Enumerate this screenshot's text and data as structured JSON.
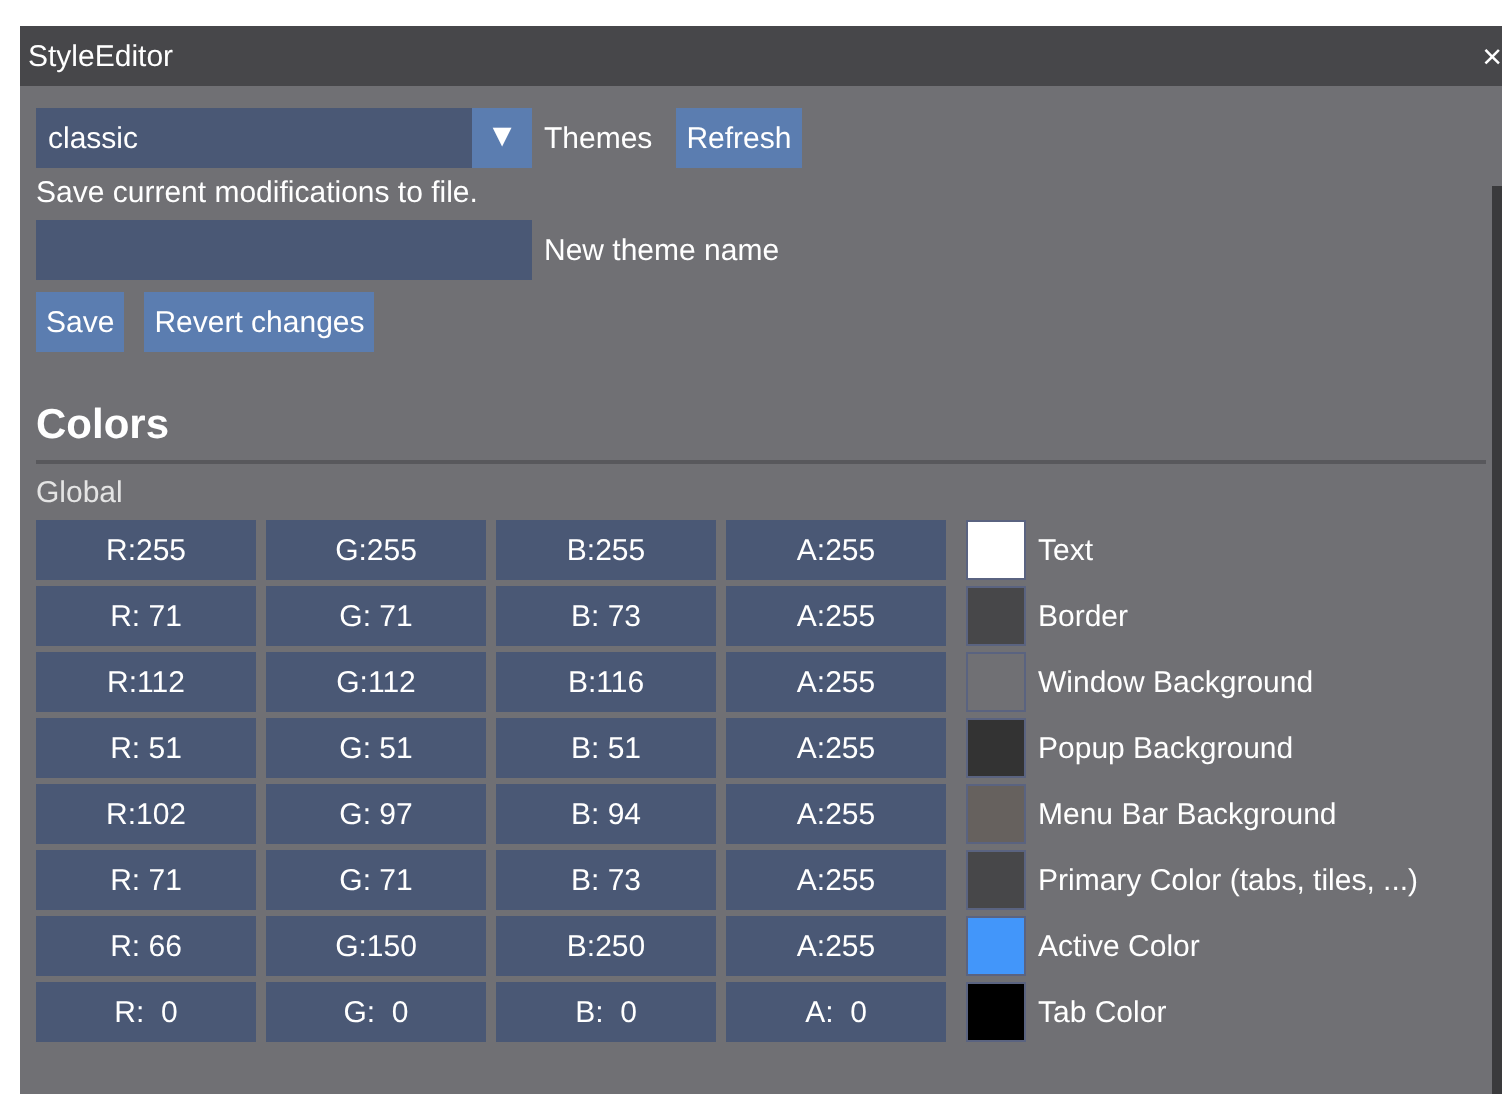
{
  "window": {
    "title": "StyleEditor",
    "close": "×"
  },
  "theme_select": {
    "value": "classic",
    "arrow": "▼",
    "label": "Themes"
  },
  "refresh_button": "Refresh",
  "save_note": "Save current modifications to file.",
  "theme_name_field": {
    "label": "New theme name"
  },
  "buttons": [
    "Save",
    "Revert changes"
  ],
  "section_heading": "Colors",
  "group_label": "Global",
  "colors": [
    {
      "channels": [
        "R:255",
        "G:255",
        "B:255",
        "A:255"
      ],
      "color": "#ffffff",
      "label": "Text"
    },
    {
      "channels": [
        "R: 71",
        "G: 71",
        "B: 73",
        "A:255"
      ],
      "color": "#474749",
      "label": "Border"
    },
    {
      "channels": [
        "R:112",
        "G:112",
        "B:116",
        "A:255"
      ],
      "color": "#707074",
      "label": "Window Background"
    },
    {
      "channels": [
        "R: 51",
        "G: 51",
        "B: 51",
        "A:255"
      ],
      "color": "#333333",
      "label": "Popup Background"
    },
    {
      "channels": [
        "R:102",
        "G: 97",
        "B: 94",
        "A:255"
      ],
      "color": "#66615e",
      "label": "Menu Bar Background"
    },
    {
      "channels": [
        "R: 71",
        "G: 71",
        "B: 73",
        "A:255"
      ],
      "color": "#474749",
      "label": "Primary Color (tabs, tiles, ...)"
    },
    {
      "channels": [
        "R: 66",
        "G:150",
        "B:250",
        "A:255"
      ],
      "color": "#4296fa",
      "label": "Active Color"
    },
    {
      "channels": [
        "R:  0",
        "G:  0",
        "B:  0",
        "A:  0"
      ],
      "color": "#000000",
      "label": "Tab Color"
    }
  ]
}
